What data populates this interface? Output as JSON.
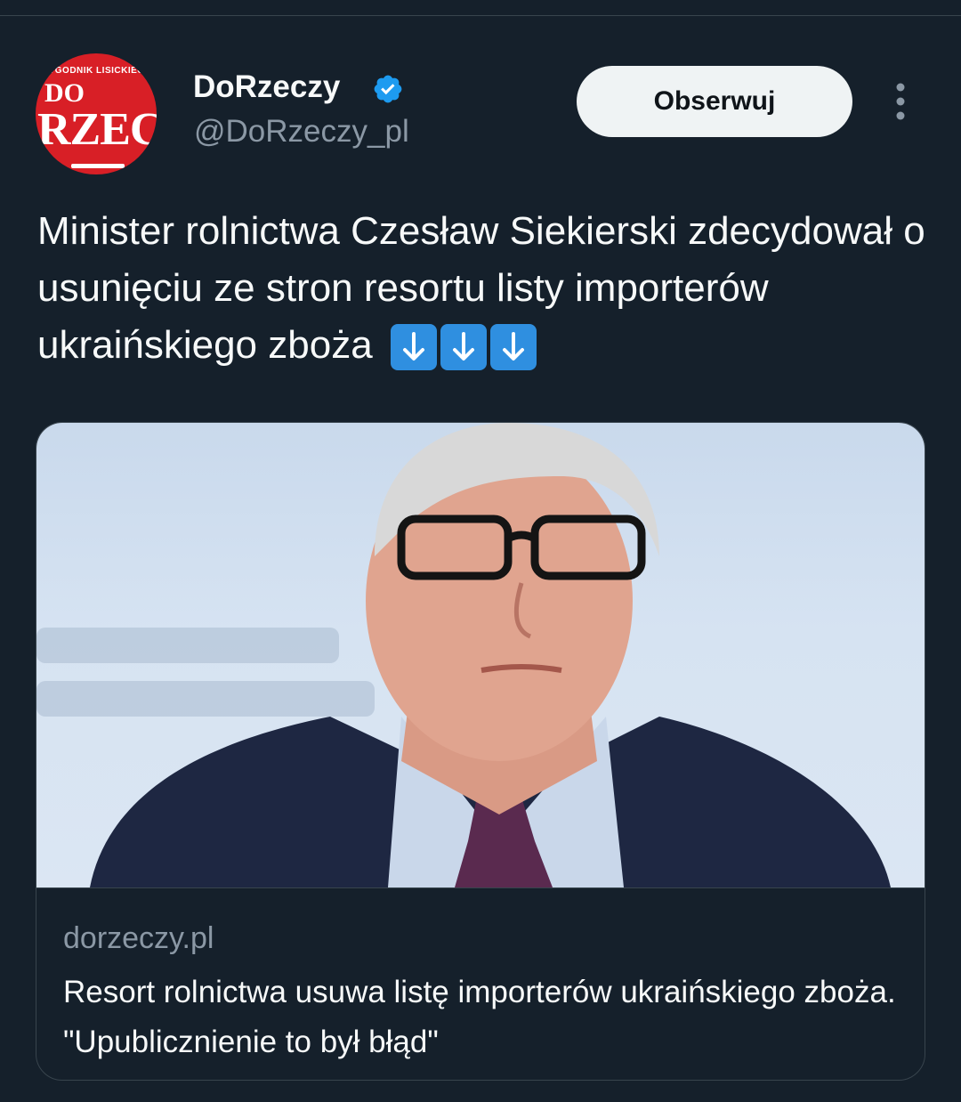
{
  "account": {
    "display_name": "DoRzeczy",
    "handle": "@DoRzeczy_pl",
    "verified": true,
    "avatar_logo": "TYGODNIK LISICKIEGO DO RZECZY"
  },
  "actions": {
    "follow_label": "Obserwuj",
    "more_icon": "more-vertical-icon"
  },
  "tweet": {
    "text": "Minister rolnictwa Czesław Siekierski zdecydował o usunięciu ze stron resortu listy importerów ukraińskiego zboża",
    "emoji": [
      "⬇️",
      "⬇️",
      "⬇️"
    ]
  },
  "link_card": {
    "image_description": "photo",
    "domain": "dorzeczy.pl",
    "title": "Resort rolnictwa usuwa listę importerów ukraińskiego zboża. \"Upublicznienie to był błąd\""
  },
  "colors": {
    "background": "#15202b",
    "text_primary": "#f7f9f9",
    "text_secondary": "#8b98a5",
    "border": "#38444d",
    "verified_blue": "#1d9bf0",
    "avatar_red": "#d81f26",
    "follow_button_bg": "#eff3f4"
  }
}
